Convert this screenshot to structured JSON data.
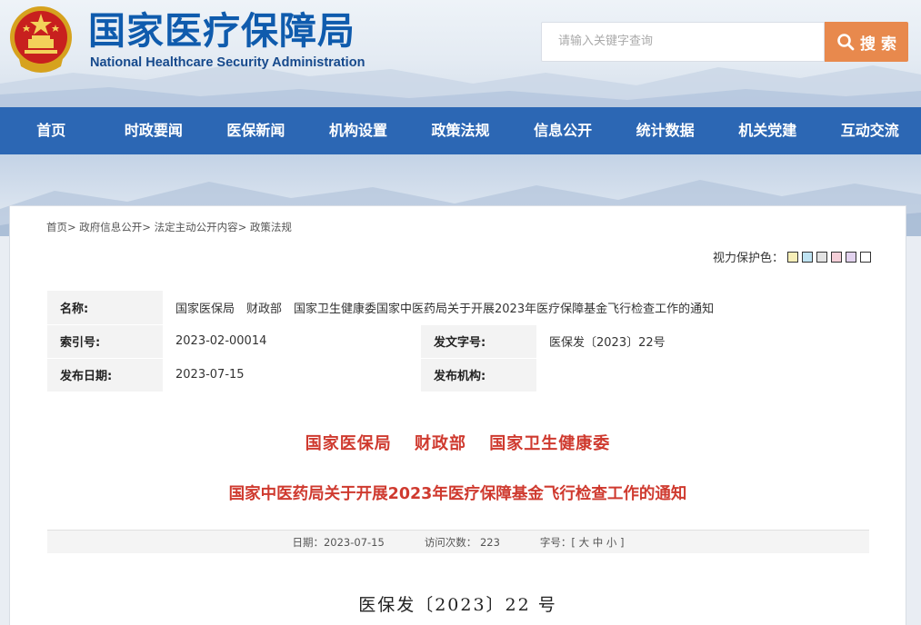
{
  "header": {
    "site_name_cn": "国家医疗保障局",
    "site_name_en": "National Healthcare Security Administration",
    "search_placeholder": "请输入关键字查询",
    "search_button": "搜 索"
  },
  "nav": {
    "items": [
      "首页",
      "时政要闻",
      "医保新闻",
      "机构设置",
      "政策法规",
      "信息公开",
      "统计数据",
      "机关党建",
      "互动交流"
    ]
  },
  "breadcrumb": "首页> 政府信息公开> 法定主动公开内容> 政策法规",
  "vision": {
    "label": "视力保护色：",
    "swatches": [
      "#f7efb8",
      "#bfe3f2",
      "#e3e3e3",
      "#f5cfd8",
      "#e2d2ee",
      "#ffffff"
    ]
  },
  "meta": {
    "name_label": "名称:",
    "name_value": "国家医保局　财政部　国家卫生健康委国家中医药局关于开展2023年医疗保障基金飞行检查工作的通知",
    "index_label": "索引号:",
    "index_value": "2023-02-00014",
    "docno_label": "发文字号:",
    "docno_value": "医保发〔2023〕22号",
    "date_label": "发布日期:",
    "date_value": "2023-07-15",
    "org_label": "发布机构:",
    "org_value": ""
  },
  "title": {
    "issuers": [
      "国家医保局",
      "财政部",
      "国家卫生健康委"
    ],
    "main": "国家中医药局关于开展2023年医疗保障基金飞行检查工作的通知"
  },
  "info": {
    "date": "日期：2023-07-15",
    "visits": "访问次数：  223",
    "font_size": "字号：[ 大 中 小 ]"
  },
  "doc_number": "医保发〔2023〕22 号",
  "colors": {
    "brand": "#2c67b4",
    "accent": "#e8894d",
    "title_red": "#cf3a2f"
  }
}
